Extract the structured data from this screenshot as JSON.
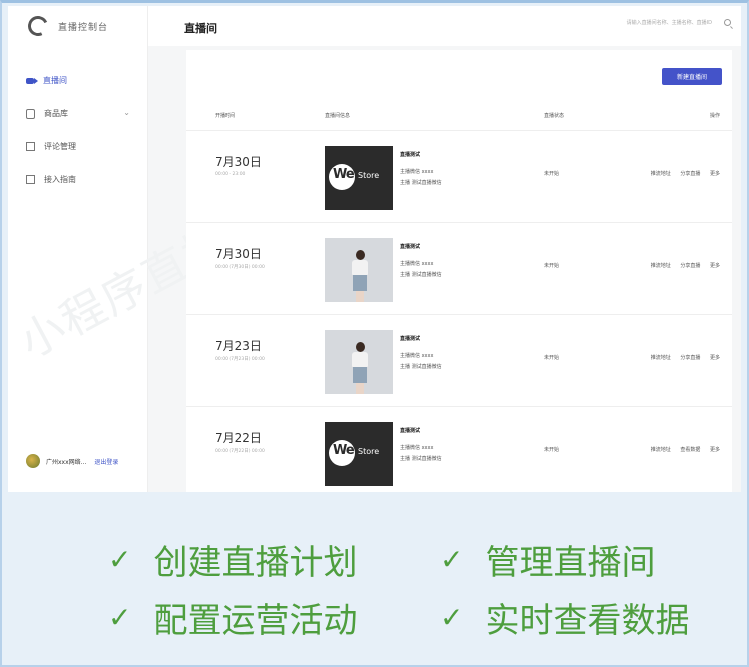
{
  "app": {
    "name": "直播控制台"
  },
  "sidebar": {
    "items": [
      {
        "label": "直播间",
        "icon": "video-icon",
        "active": true
      },
      {
        "label": "商品库",
        "icon": "bag-icon",
        "expandable": true
      },
      {
        "label": "评论管理",
        "icon": "comment-icon"
      },
      {
        "label": "接入指南",
        "icon": "guide-icon"
      }
    ],
    "account": {
      "name": "广州xxx网络...",
      "action": "退出登录"
    }
  },
  "header": {
    "title": "直播间",
    "search_placeholder": "请输入直播间名称、主播名称、直播ID"
  },
  "main": {
    "new_button": "新建直播间",
    "columns": [
      "开播时间",
      "直播间信息",
      "直播状态",
      "操作"
    ],
    "rows": [
      {
        "date": "7月30日",
        "time": "00:00 - 23:00",
        "thumb": "westore",
        "title": "直播测试",
        "line1": "主播微信  xxxx",
        "line2": "主播  测试直播微信",
        "status": "未开始",
        "actions": [
          "推流地址",
          "分享直播",
          "更多"
        ]
      },
      {
        "date": "7月30日",
        "time": "00:00 (7月30日) 00:00",
        "thumb": "person",
        "title": "直播测试",
        "line1": "主播微信  xxxx",
        "line2": "主播  测试直播微信",
        "status": "未开始",
        "actions": [
          "推流地址",
          "分享直播",
          "更多"
        ]
      },
      {
        "date": "7月23日",
        "time": "00:00 (7月23日) 00:00",
        "thumb": "person",
        "title": "直播测试",
        "line1": "主播微信  xxxx",
        "line2": "主播  测试直播微信",
        "status": "未开始",
        "actions": [
          "推流地址",
          "分享直播",
          "更多"
        ]
      },
      {
        "date": "7月22日",
        "time": "00:00 (7月22日) 00:00",
        "thumb": "westore",
        "title": "直播测试",
        "line1": "主播微信  xxxx",
        "line2": "主播  测试直播微信",
        "status": "未开始",
        "actions": [
          "推流地址",
          "查看数据",
          "更多"
        ]
      }
    ],
    "thumb_brand": {
      "we": "We",
      "store": "Store"
    }
  },
  "watermark": "小程序直播",
  "features": [
    {
      "check": "✓",
      "label": "创建直播计划"
    },
    {
      "check": "✓",
      "label": "管理直播间"
    },
    {
      "check": "✓",
      "label": "配置运营活动"
    },
    {
      "check": "✓",
      "label": "实时查看数据"
    }
  ],
  "colors": {
    "accent": "#4453c9",
    "feature_green": "#4e9e3e",
    "frame_blue": "#b7d1ea"
  }
}
